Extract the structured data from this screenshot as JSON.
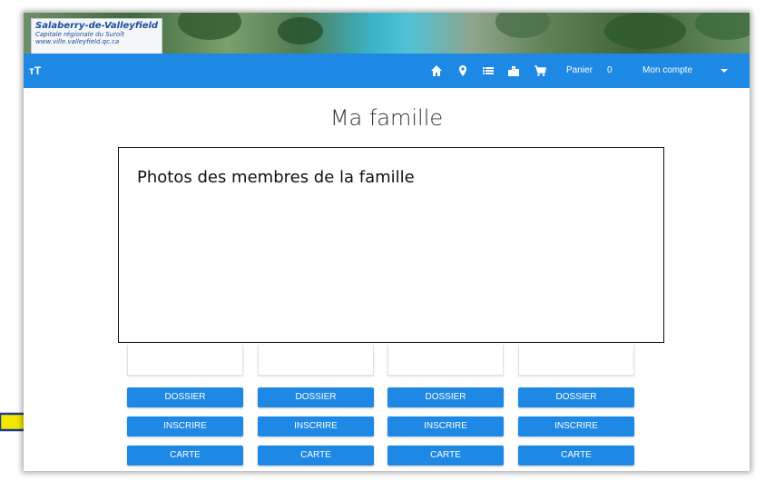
{
  "logo": {
    "line1": "Salaberry-de-Valleyfield",
    "line2": "Capitale régionale du Suroît",
    "line3": "www.ville.valleyfield.qc.ca"
  },
  "navbar": {
    "left_icon": "text-size-icon",
    "left_glyph": "тT",
    "icons": [
      "home-icon",
      "location-pin-icon",
      "list-icon",
      "city-building-icon",
      "cart-icon"
    ],
    "cart_label": "Panier",
    "cart_count": "0",
    "account_label": "Mon compte",
    "color": "#1e88e5"
  },
  "main": {
    "title": "Ma famille",
    "photos_box_text": "Photos des membres de la famille"
  },
  "members": [
    {
      "dossier": "DOSSIER",
      "inscrire": "INSCRIRE",
      "carte": "CARTE"
    },
    {
      "dossier": "DOSSIER",
      "inscrire": "INSCRIRE",
      "carte": "CARTE"
    },
    {
      "dossier": "DOSSIER",
      "inscrire": "INSCRIRE",
      "carte": "CARTE"
    },
    {
      "dossier": "DOSSIER",
      "inscrire": "INSCRIRE",
      "carte": "CARTE"
    }
  ],
  "annotation": {
    "arrow_color": "#f5e600",
    "arrow_outline": "#1a3c8c"
  }
}
